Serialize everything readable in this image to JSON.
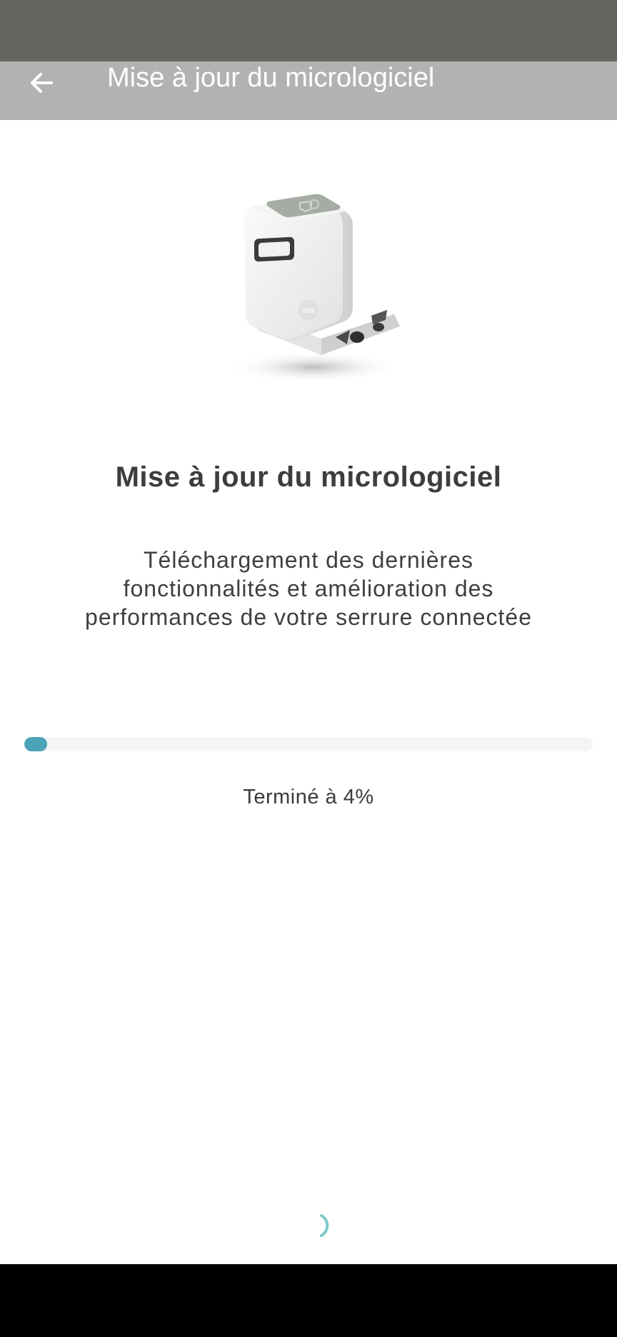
{
  "app_bar": {
    "title": "Mise à jour du micrologiciel",
    "back_icon": "arrow-left-icon"
  },
  "main": {
    "illustration": "smart-lock-device-image",
    "title": "Mise à jour du micrologiciel",
    "description": "Téléchargement des dernières fonctionnalités et amélioration des performances de votre serrure connectée"
  },
  "progress": {
    "value_percent": 4,
    "label": "Terminé à 4%"
  },
  "spinner": {
    "icon": "loading-spinner-icon"
  },
  "colors": {
    "status_bar": "#636561",
    "app_bar": "#b2b2b2",
    "accent": "#4aa3b6",
    "spinner": "#7ec8c8",
    "nav_bar": "#000000"
  }
}
